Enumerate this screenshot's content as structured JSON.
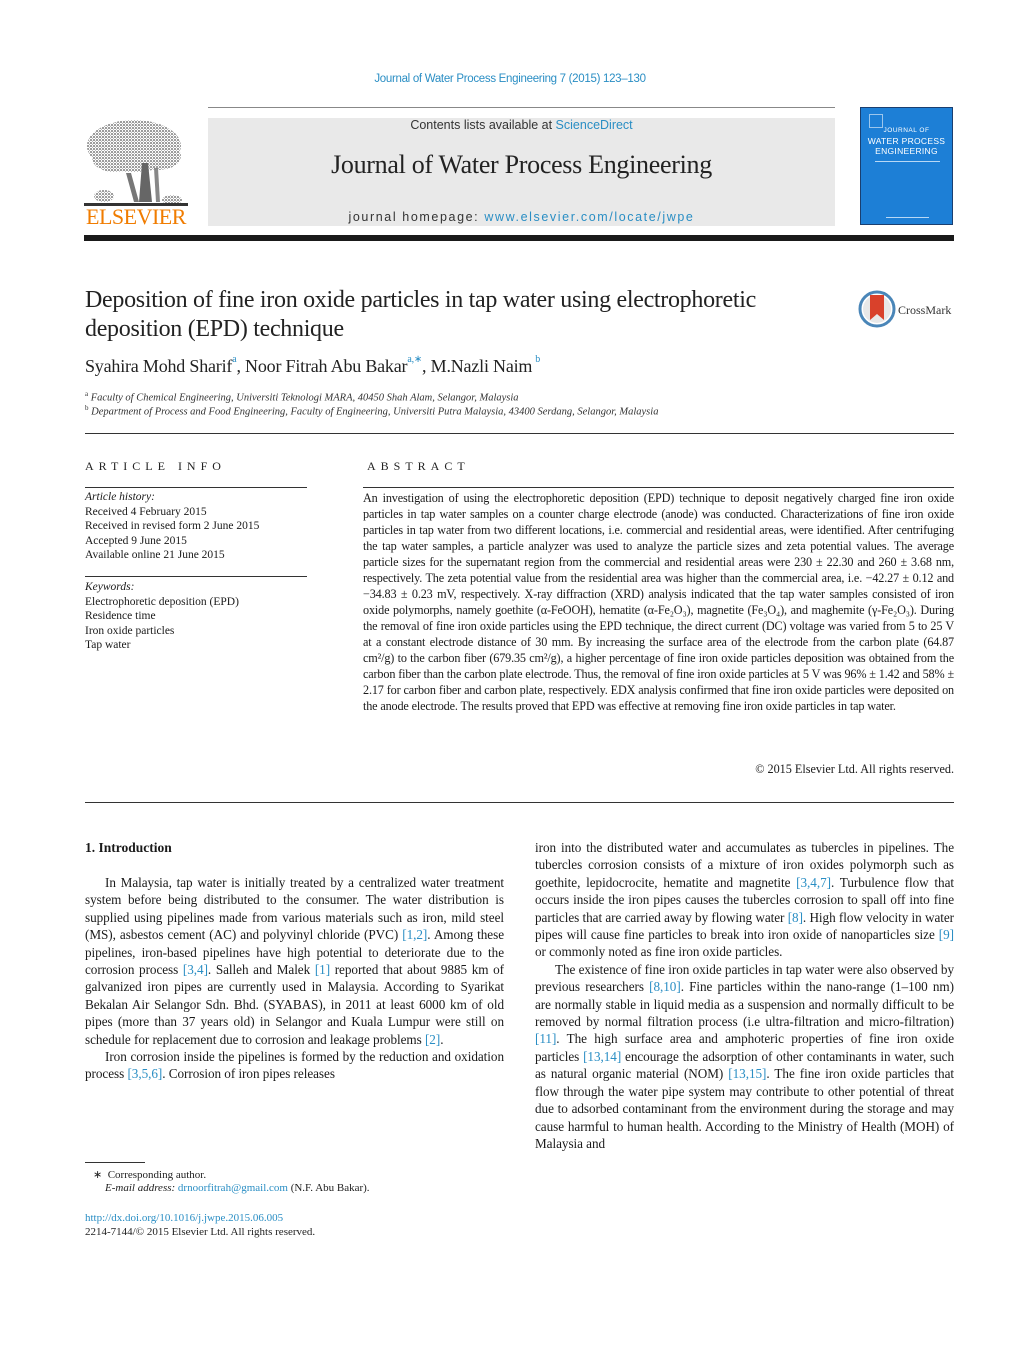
{
  "header": {
    "journal_citation": "Journal of Water Process Engineering 7 (2015) 123–130",
    "contents_prefix": "Contents lists available at ",
    "contents_link": "ScienceDirect",
    "journal_title": "Journal of Water Process Engineering",
    "homepage_prefix": "journal homepage: ",
    "homepage_link": "www.elsevier.com/locate/jwpe",
    "publisher_logo_text": "ELSEVIER",
    "cover": {
      "line1": "JOURNAL OF",
      "line2": "WATER PROCESS",
      "line3": "ENGINEERING"
    },
    "colors": {
      "link": "#2a8ec4",
      "elsevier_orange": "#f07c00",
      "cover_blue": "#1d7fd6"
    }
  },
  "article": {
    "title": "Deposition of fine iron oxide particles in tap water using electrophoretic deposition (EPD) technique",
    "crossmark_label": "CrossMark",
    "authors": [
      {
        "name": "Syahira Mohd Sharif",
        "sup": "a"
      },
      {
        "name": "Noor Fitrah Abu Bakar",
        "sup": "a,∗"
      },
      {
        "name": "M.Nazli Naim",
        "sup": "b"
      }
    ],
    "affiliations": [
      {
        "sup": "a",
        "text": "Faculty of Chemical Engineering, Universiti Teknologi MARA, 40450 Shah Alam, Selangor, Malaysia"
      },
      {
        "sup": "b",
        "text": "Department of Process and Food Engineering, Faculty of Engineering, Universiti Putra Malaysia, 43400 Serdang, Selangor, Malaysia"
      }
    ]
  },
  "article_info": {
    "heading": "ARTICLE INFO",
    "history_label": "Article history:",
    "history": [
      "Received 4 February 2015",
      "Received in revised form 2 June 2015",
      "Accepted 9 June 2015",
      "Available online 21 June 2015"
    ],
    "keywords_label": "Keywords:",
    "keywords": [
      "Electrophoretic deposition (EPD)",
      "Residence time",
      "Iron oxide particles",
      "Tap water"
    ]
  },
  "abstract": {
    "heading": "ABSTRACT",
    "text": "An investigation of using the electrophoretic deposition (EPD) technique to deposit negatively charged fine iron oxide particles in tap water samples on a counter charge electrode (anode) was conducted. Characterizations of fine iron oxide particles in tap water from two different locations, i.e. commercial and residential areas, were identified. After centrifuging the tap water samples, a particle analyzer was used to analyze the particle sizes and zeta potential values. The average particle sizes for the supernatant region from the commercial and residential areas were 230 ± 22.30 and 260 ± 3.68 nm, respectively. The zeta potential value from the residential area was higher than the commercial area, i.e. −42.27 ± 0.12 and −34.83 ± 0.23 mV, respectively. X-ray diffraction (XRD) analysis indicated that the tap water samples consisted of iron oxide polymorphs, namely goethite (α-FeOOH), hematite (α-Fe₂O₃), magnetite (Fe₃O₄), and maghemite (γ-Fe₂O₃). During the removal of fine iron oxide particles using the EPD technique, the direct current (DC) voltage was varied from 5 to 25 V at a constant electrode distance of 30 mm. By increasing the surface area of the electrode from the carbon plate (64.87 cm²/g) to the carbon fiber (679.35 cm²/g), a higher percentage of fine iron oxide particles deposition was obtained from the carbon fiber than the carbon plate electrode. Thus, the removal of fine iron oxide particles at 5 V was 96% ± 1.42 and 58% ± 2.17 for carbon fiber and carbon plate, respectively. EDX analysis confirmed that fine iron oxide particles were deposited on the anode electrode. The results proved that EPD was effective at removing fine iron oxide particles in tap water.",
    "copyright": "© 2015 Elsevier Ltd. All rights reserved."
  },
  "introduction": {
    "heading": "1.  Introduction",
    "left_column": [
      {
        "indent": true,
        "parts": [
          {
            "t": "In Malaysia, tap water is initially treated by a centralized water treatment system before being distributed to the consumer. The water distribution is supplied using pipelines made from various materials such as iron, mild steel (MS), asbestos cement (AC) and polyvinyl chloride (PVC) "
          },
          {
            "ref": "[1,2]"
          },
          {
            "t": ". Among these pipelines, iron-based pipelines have high potential to deteriorate due to the corrosion process "
          },
          {
            "ref": "[3,4]"
          },
          {
            "t": ". Salleh and Malek "
          },
          {
            "ref": "[1]"
          },
          {
            "t": " reported that about 9885 km of galvanized iron pipes are currently used in Malaysia. According to Syarikat Bekalan Air Selangor Sdn. Bhd. (SYABAS), in 2011 at least 6000 km of old pipes (more than 37 years old) in Selangor and Kuala Lumpur were still on schedule for replacement due to corrosion and leakage problems "
          },
          {
            "ref": "[2]"
          },
          {
            "t": "."
          }
        ]
      },
      {
        "indent": true,
        "parts": [
          {
            "t": "Iron corrosion inside the pipelines is formed by the reduction and oxidation process "
          },
          {
            "ref": "[3,5,6]"
          },
          {
            "t": ". Corrosion of iron pipes releases"
          }
        ]
      }
    ],
    "right_column": [
      {
        "indent": false,
        "parts": [
          {
            "t": "iron into the distributed water and accumulates as tubercles in pipelines. The tubercles corrosion consists of a mixture of iron oxides polymorph such as goethite, lepidocrocite, hematite and magnetite "
          },
          {
            "ref": "[3,4,7]"
          },
          {
            "t": ". Turbulence flow that occurs inside the iron pipes causes the tubercles corrosion to spall off into fine particles that are carried away by flowing water "
          },
          {
            "ref": "[8]"
          },
          {
            "t": ". High flow velocity in water pipes will cause fine particles to break into iron oxide of nanoparticles size "
          },
          {
            "ref": "[9]"
          },
          {
            "t": " or commonly noted as fine iron oxide particles."
          }
        ]
      },
      {
        "indent": true,
        "parts": [
          {
            "t": "The existence of fine iron oxide particles in tap water were also observed by previous researchers "
          },
          {
            "ref": "[8,10]"
          },
          {
            "t": ". Fine particles within the nano-range (1–100 nm) are normally stable in liquid media as a suspension and normally difficult to be removed by normal filtration process (i.e ultra-filtration and micro-filtration) "
          },
          {
            "ref": "[11]"
          },
          {
            "t": ". The high surface area and amphoteric properties of fine iron oxide particles "
          },
          {
            "ref": "[13,14]"
          },
          {
            "t": " encourage the adsorption of other contaminants in water, such as natural organic material (NOM) "
          },
          {
            "ref": "[13,15]"
          },
          {
            "t": ". The fine iron oxide particles that flow through the water pipe system may contribute to other potential of threat due to adsorbed contaminant from the environment during the storage and may cause harmful to human health. According to the Ministry of Health (MOH) of Malaysia and"
          }
        ]
      }
    ]
  },
  "footnotes": {
    "corresponding_mark": "∗",
    "corresponding_label": "Corresponding author.",
    "email_label": "E-mail address: ",
    "email": "drnoorfitrah@gmail.com",
    "email_suffix": " (N.F. Abu Bakar).",
    "doi": "http://dx.doi.org/10.1016/j.jwpe.2015.06.005",
    "issn_line": "2214-7144/© 2015 Elsevier Ltd. All rights reserved."
  }
}
